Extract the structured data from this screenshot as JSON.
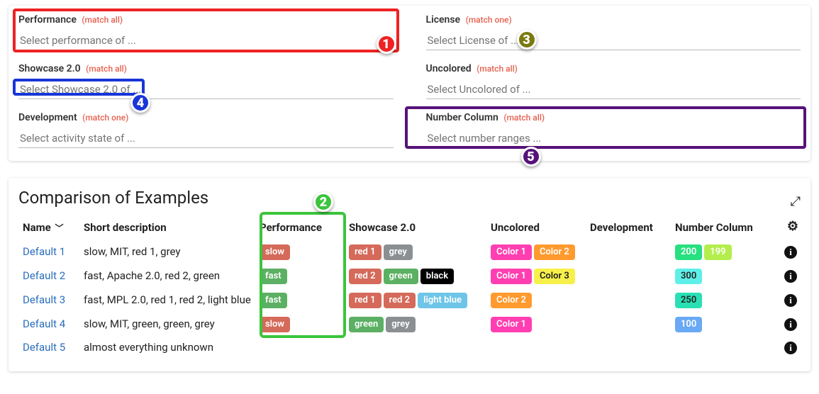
{
  "filters": {
    "performance": {
      "label": "Performance",
      "match": "(match all)",
      "placeholder": "Select performance of ..."
    },
    "license": {
      "label": "License",
      "match": "(match one)",
      "placeholder": "Select License of ..."
    },
    "showcase": {
      "label": "Showcase 2.0",
      "match": "(match all)",
      "placeholder": "Select Showcase 2.0 of ..."
    },
    "uncolored": {
      "label": "Uncolored",
      "match": "(match all)",
      "placeholder": "Select Uncolored of ..."
    },
    "development": {
      "label": "Development",
      "match": "(match one)",
      "placeholder": "Select activity state of ..."
    },
    "number": {
      "label": "Number Column",
      "match": "(match all)",
      "placeholder": "Select number ranges ..."
    }
  },
  "annotations": {
    "n1": "1",
    "n2": "2",
    "n3": "3",
    "n4": "4",
    "n5": "5"
  },
  "comparison": {
    "title": "Comparison of Examples",
    "columns": {
      "name": "Name",
      "desc": "Short description",
      "perf": "Performance",
      "show": "Showcase 2.0",
      "uncol": "Uncolored",
      "dev": "Development",
      "num": "Number Column"
    },
    "colors": {
      "slow": "#d56a5a",
      "fast": "#5cb063",
      "red": "#d56a5a",
      "grey": "#8b8f92",
      "green": "#5cb063",
      "black": "#000000",
      "lightblue": "#6ec5e8",
      "color1": "#ff3fb1",
      "color2": "#ff9a2e",
      "color3": "#f8f04a",
      "n200": "#27e07f",
      "n199": "#b4ee4c",
      "n300": "#5ef0e8",
      "n250": "#28e0b4",
      "n100": "#6aa9f5"
    },
    "rows": [
      {
        "name": "Default 1",
        "desc": "slow, MIT, red 1, grey",
        "perf": [
          {
            "t": "slow",
            "c": "slow"
          }
        ],
        "show": [
          {
            "t": "red 1",
            "c": "red"
          },
          {
            "t": "grey",
            "c": "grey"
          }
        ],
        "uncol": [
          {
            "t": "Color 1",
            "c": "color1"
          },
          {
            "t": "Color 2",
            "c": "color2"
          }
        ],
        "dev": "",
        "num": [
          {
            "t": "200",
            "c": "n200"
          },
          {
            "t": "199",
            "c": "n199"
          }
        ]
      },
      {
        "name": "Default 2",
        "desc": "fast, Apache 2.0, red 2, green",
        "perf": [
          {
            "t": "fast",
            "c": "fast"
          }
        ],
        "show": [
          {
            "t": "red 2",
            "c": "red"
          },
          {
            "t": "green",
            "c": "green"
          },
          {
            "t": "black",
            "c": "black"
          }
        ],
        "uncol": [
          {
            "t": "Color 1",
            "c": "color1"
          },
          {
            "t": "Color 3",
            "c": "color3",
            "dark": true
          }
        ],
        "dev": "",
        "num": [
          {
            "t": "300",
            "c": "n300",
            "dark": true
          }
        ]
      },
      {
        "name": "Default 3",
        "desc": "fast, MPL 2.0, red 1, red 2, light blue",
        "perf": [
          {
            "t": "fast",
            "c": "fast"
          }
        ],
        "show": [
          {
            "t": "red 1",
            "c": "red"
          },
          {
            "t": "red 2",
            "c": "red"
          },
          {
            "t": "light blue",
            "c": "lightblue"
          }
        ],
        "uncol": [
          {
            "t": "Color 2",
            "c": "color2"
          }
        ],
        "dev": "",
        "num": [
          {
            "t": "250",
            "c": "n250",
            "dark": true
          }
        ]
      },
      {
        "name": "Default 4",
        "desc": "slow, MIT, green, green, grey",
        "perf": [
          {
            "t": "slow",
            "c": "slow"
          }
        ],
        "show": [
          {
            "t": "green",
            "c": "green"
          },
          {
            "t": "grey",
            "c": "grey"
          }
        ],
        "uncol": [
          {
            "t": "Color 1",
            "c": "color1"
          }
        ],
        "dev": "",
        "num": [
          {
            "t": "100",
            "c": "n100"
          }
        ]
      },
      {
        "name": "Default 5",
        "desc": "almost everything unknown",
        "perf": [],
        "show": [],
        "uncol": [],
        "dev": "",
        "num": []
      }
    ]
  }
}
